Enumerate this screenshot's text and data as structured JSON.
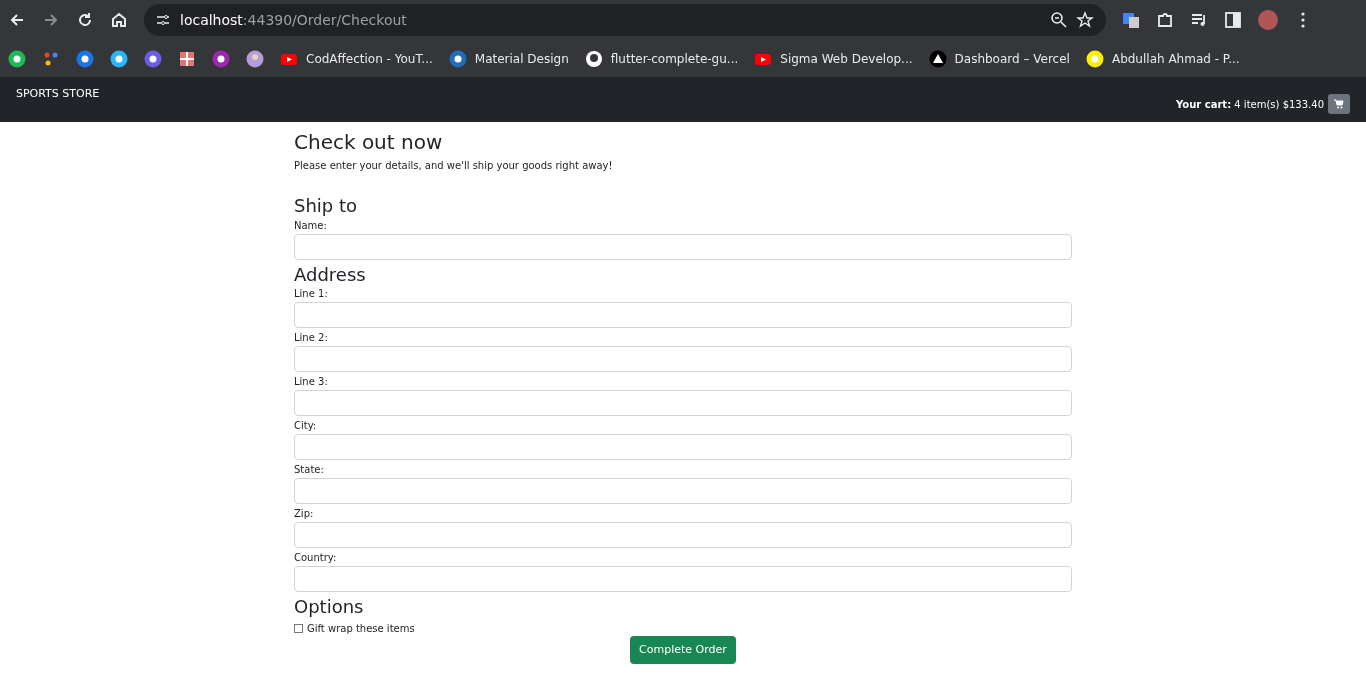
{
  "browser": {
    "url_host": "localhost",
    "url_path": ":44390/Order/Checkout",
    "bookmarks": [
      {
        "kind": "site",
        "color": "#1db954"
      },
      {
        "kind": "dots",
        "color": "#ea4335"
      },
      {
        "kind": "site",
        "color": "#1a73e8"
      },
      {
        "kind": "site",
        "color": "#29b6f6"
      },
      {
        "kind": "site",
        "color": "#6c5ce7"
      },
      {
        "kind": "grid",
        "color": "#e57373"
      },
      {
        "kind": "site",
        "color": "#9c27b0"
      },
      {
        "kind": "person",
        "color": "#b39ddb"
      },
      {
        "kind": "youtube",
        "color": "#ff0000",
        "label": "CodAffection - YouT..."
      },
      {
        "kind": "site",
        "color": "#1e6fb8",
        "label": "Material Design"
      },
      {
        "kind": "github",
        "color": "#ffffff",
        "label": "flutter-complete-gu..."
      },
      {
        "kind": "youtube",
        "color": "#ff0000",
        "label": "Sigma Web Develop..."
      },
      {
        "kind": "vercel",
        "color": "#000000",
        "label": "Dashboard – Vercel"
      },
      {
        "kind": "site",
        "color": "#ffee00",
        "label": "Abdullah Ahmad - P..."
      }
    ]
  },
  "navbar": {
    "brand": "SPORTS STORE",
    "cart_summary": "**Your cart:** 4 item(s) $133.40"
  },
  "page": {
    "title": "Check out now",
    "intro": "Please enter your details, and we'll ship your goods right away!",
    "sections": [
      {
        "heading": "Ship to",
        "fields": [
          {
            "label": "Name:"
          }
        ]
      },
      {
        "heading": "Address",
        "fields": [
          {
            "label": "Line 1:"
          },
          {
            "label": "Line 2:"
          },
          {
            "label": "Line 3:"
          },
          {
            "label": "City:"
          },
          {
            "label": "State:"
          },
          {
            "label": "Zip:"
          },
          {
            "label": "Country:"
          }
        ]
      }
    ],
    "options": {
      "heading": "Options",
      "checkboxes": [
        {
          "label": "Gift wrap these items",
          "checked": false
        }
      ]
    },
    "submit": "Complete Order"
  }
}
